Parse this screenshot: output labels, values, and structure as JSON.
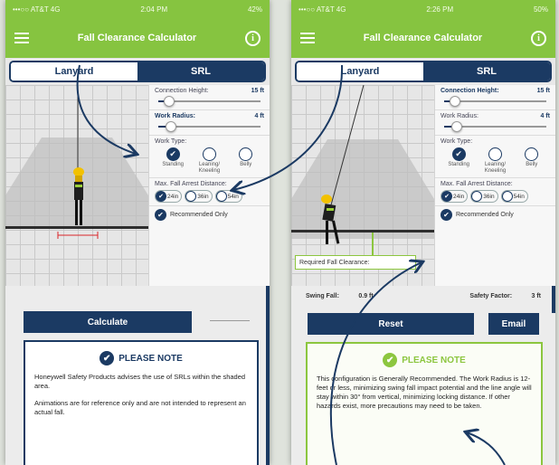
{
  "statusbar": {
    "carrier": "•••○○ AT&T 4G",
    "time_left": "2:04 PM",
    "time_right": "2:26 PM",
    "battery_left": "42%",
    "battery_right": "50%"
  },
  "app": {
    "title": "Fall Clearance Calculator",
    "info": "i"
  },
  "tabs": {
    "lanyard": "Lanyard",
    "srl": "SRL"
  },
  "panel": {
    "connection_height_label": "Connection Height:",
    "connection_height_value": "15 ft",
    "connection_height_level": 0.1,
    "work_radius_label": "Work Radius:",
    "work_radius_value_left": "4 ft",
    "work_radius_value_right": "4 ft",
    "work_radius_level": 0.12,
    "work_type_label": "Work Type:",
    "work_types": [
      "Standing",
      "Leaning/ Kneeling",
      "Belly"
    ],
    "max_distance_label": "Max. Fall Arrest Distance:",
    "distances": [
      "24in",
      "36in",
      "54in"
    ],
    "recommended_only": "Recommended Only"
  },
  "left": {
    "calculate": "Calculate",
    "note_title": "PLEASE NOTE",
    "note_p1": "Honeywell Safety Products advises the use of SRLs within the shaded area.",
    "note_p2": "Animations are for reference only and are not intended to represent an actual fall."
  },
  "right": {
    "required_label": "Required Fall Clearance:",
    "swing_fall_label": "Swing Fall:",
    "swing_fall_value": "0.9 ft",
    "safety_factor_label": "Safety Factor:",
    "safety_factor_value": "3 ft",
    "reset": "Reset",
    "email": "Email",
    "note_title": "PLEASE NOTE",
    "note_text": "This configuration is Generally Recommended. The Work Radius is 12-feet or less, minimizing swing fall impact potential and the line angle will stay within 30° from vertical, minimizing locking distance. If other hazards exist, more precautions may need to be taken."
  },
  "colors": {
    "green": "#86c440",
    "navy": "#1b3a63",
    "highlight": "#8cc63f"
  },
  "icons": [
    "menu-icon",
    "info-icon",
    "check-icon",
    "annotation-arrow"
  ]
}
